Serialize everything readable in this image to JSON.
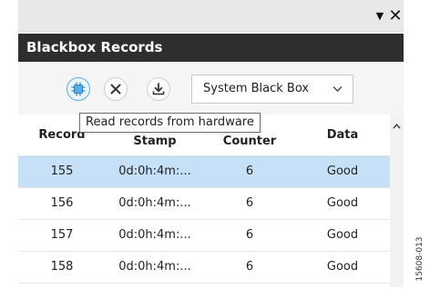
{
  "window": {
    "pin_glyph": "▼",
    "close_glyph": "✕",
    "title": "Blackbox Records"
  },
  "toolbar": {
    "buttons": [
      {
        "icon": "chip-icon",
        "tooltip": "Read records from hardware",
        "active": true
      },
      {
        "icon": "cancel-icon"
      },
      {
        "icon": "download-icon"
      }
    ],
    "select_value": "System Black Box",
    "accent_color": "#5aaee8"
  },
  "table": {
    "columns": [
      {
        "line1": "Record",
        "line2": ""
      },
      {
        "line1": "Stamp",
        "line2": ""
      },
      {
        "line1": "Counter",
        "line2": ""
      },
      {
        "line1": "Data",
        "line2": ""
      }
    ],
    "rows": [
      {
        "record": "155",
        "stamp": "0d:0h:4m:...",
        "counter": "6",
        "data": "Good",
        "selected": true
      },
      {
        "record": "156",
        "stamp": "0d:0h:4m:...",
        "counter": "6",
        "data": "Good"
      },
      {
        "record": "157",
        "stamp": "0d:0h:4m:...",
        "counter": "6",
        "data": "Good"
      },
      {
        "record": "158",
        "stamp": "0d:0h:4m:...",
        "counter": "6",
        "data": "Good"
      }
    ],
    "selected_color": "#c6e0f7",
    "scroll_glyph": "⌃"
  },
  "figure_ref": "15608-013"
}
